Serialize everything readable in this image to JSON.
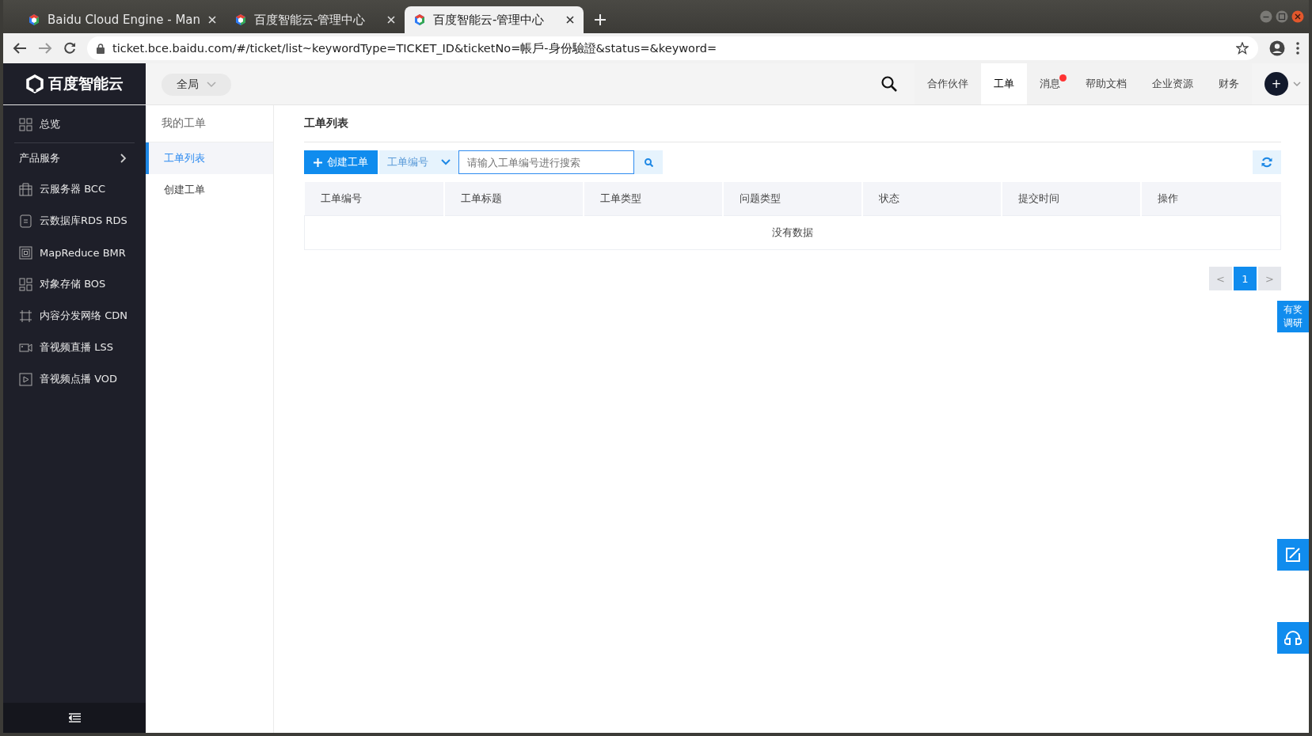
{
  "browser": {
    "tabs": [
      {
        "title": "Baidu Cloud Engine - Man",
        "selected": false
      },
      {
        "title": "百度智能云-管理中心",
        "selected": false
      },
      {
        "title": "百度智能云-管理中心",
        "selected": true
      }
    ],
    "url": "ticket.bce.baidu.com/#/ticket/list~keywordType=TICKET_ID&ticketNo=帳戶-身份驗證&status=&keyword="
  },
  "header": {
    "logo": "百度智能云",
    "scope": "全局",
    "nav": [
      {
        "label": "合作伙伴",
        "selected": false,
        "notification": false
      },
      {
        "label": "工单",
        "selected": true,
        "notification": false
      },
      {
        "label": "消息",
        "selected": false,
        "notification": true
      },
      {
        "label": "帮助文档",
        "selected": false,
        "notification": false
      },
      {
        "label": "企业资源",
        "selected": false,
        "notification": false
      },
      {
        "label": "财务",
        "selected": false,
        "notification": false
      }
    ],
    "avatar": "+"
  },
  "sidebar": {
    "items": [
      {
        "kind": "link",
        "label": "总览"
      },
      {
        "kind": "group",
        "label": "产品服务"
      },
      {
        "kind": "link",
        "label": "云服务器 BCC"
      },
      {
        "kind": "link",
        "label": "云数据库RDS RDS"
      },
      {
        "kind": "link",
        "label": "MapReduce BMR"
      },
      {
        "kind": "link",
        "label": "对象存储 BOS"
      },
      {
        "kind": "link",
        "label": "内容分发网络 CDN"
      },
      {
        "kind": "link",
        "label": "音视频直播 LSS"
      },
      {
        "kind": "link",
        "label": "音视频点播 VOD"
      }
    ]
  },
  "subnav": {
    "title": "我的工单",
    "items": [
      {
        "label": "工单列表",
        "selected": true
      },
      {
        "label": "创建工单",
        "selected": false
      }
    ]
  },
  "main": {
    "title": "工单列表",
    "create_button": "创建工单",
    "search_type": "工单编号",
    "search_placeholder": "请输入工单编号进行搜索",
    "table": {
      "columns": [
        "工单编号",
        "工单标题",
        "工单类型",
        "问题类型",
        "状态",
        "提交时间",
        "操作"
      ],
      "empty_text": "没有数据"
    },
    "pagination": {
      "prev": "<",
      "pages": [
        {
          "label": "1",
          "selected": true
        }
      ],
      "next": ">"
    }
  },
  "floating": {
    "survey": "有奖调研"
  }
}
